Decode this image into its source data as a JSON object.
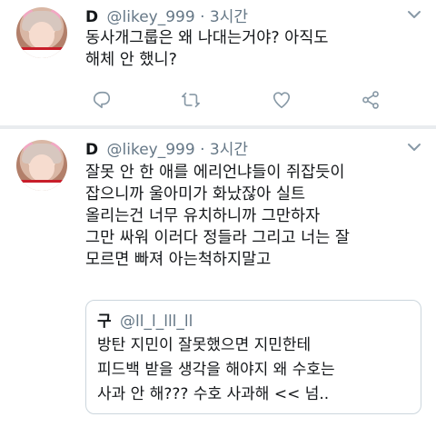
{
  "tweets": [
    {
      "name": "D",
      "handle": "@likey_999",
      "separator": "·",
      "time": "3시간",
      "text": "동사개그룹은 왜 나대는거야? 아직도\n해체 안 했니?",
      "avatar_icon": "profile-photo"
    },
    {
      "name": "D",
      "handle": "@likey_999",
      "separator": "·",
      "time": "3시간",
      "text": "잘못 안 한 애를 에리언냐들이 쥐잡듯이\n잡으니까 울아미가 화났잖아 실트\n올리는건  너무 유치하니까 그만하자\n그만 싸워 이러다 정들라 그리고 너는 잘\n모르면 빠져 아는척하지말고",
      "avatar_icon": "profile-photo",
      "quote": {
        "name": "구",
        "handle": "@ll_l_lll_ll",
        "text": "방탄 지민이 잘못했으면 지민한테\n피드백 받을 생각을 해야지 왜 수호는\n사과 안 해??? 수호 사과해 << 넘.."
      }
    }
  ],
  "icons": {
    "caret": "chevron-down-icon",
    "reply": "reply-icon",
    "retweet": "retweet-icon",
    "like": "heart-icon",
    "share": "share-icon"
  },
  "colors": {
    "text": "#14171a",
    "secondary": "#657786",
    "icon": "#8899a6",
    "divider": "#e9ecef",
    "quote_border": "#ccd6dd"
  }
}
